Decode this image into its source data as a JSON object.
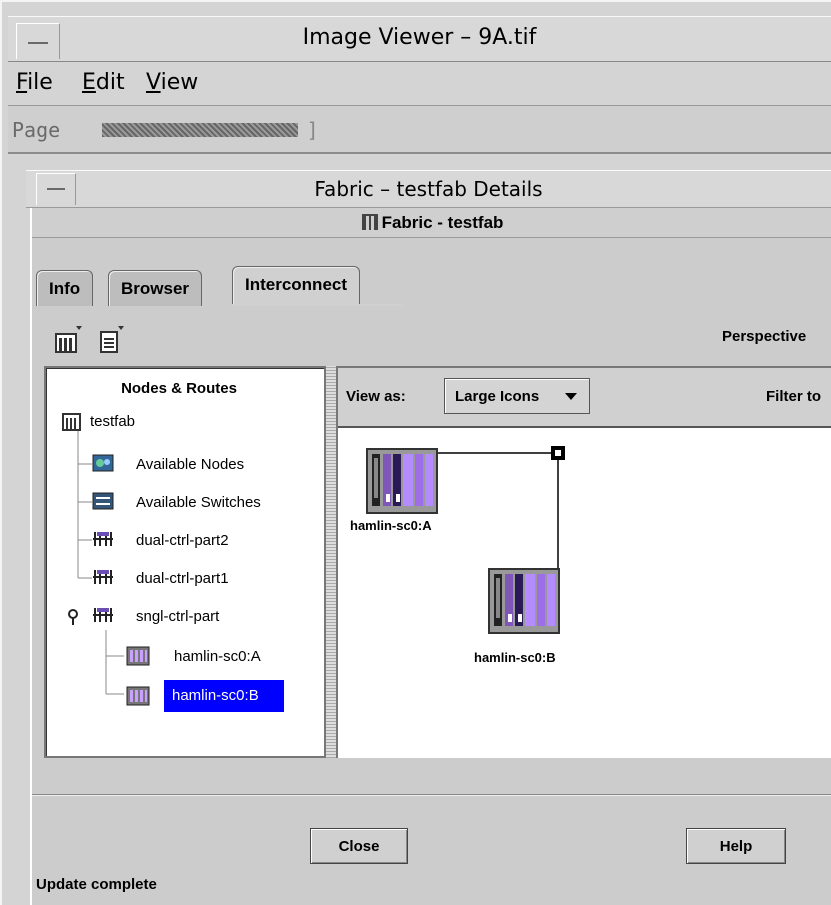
{
  "window": {
    "title": "Image Viewer – 9A.tif"
  },
  "menu": {
    "file": "File",
    "edit": "Edit",
    "view": "View"
  },
  "pagebar": {
    "label": "Page",
    "bracket": "]"
  },
  "inner_window": {
    "title": "Fabric – testfab Details"
  },
  "dialog": {
    "header": "Fabric - testfab",
    "tabs": [
      {
        "label": "Info"
      },
      {
        "label": "Browser"
      },
      {
        "label": "Interconnect"
      }
    ],
    "perspective_label": "Perspective",
    "tree": {
      "title": "Nodes & Routes",
      "items": [
        {
          "label": "testfab",
          "icon": "fabric-icon"
        },
        {
          "label": "Available Nodes",
          "icon": "nodes-icon"
        },
        {
          "label": "Available Switches",
          "icon": "switches-icon"
        },
        {
          "label": "dual-ctrl-part2",
          "icon": "partition-icon"
        },
        {
          "label": "dual-ctrl-part1",
          "icon": "partition-icon"
        },
        {
          "label": "sngl-ctrl-part",
          "icon": "partition-icon"
        },
        {
          "label": "hamlin-sc0:A",
          "icon": "node-icon"
        },
        {
          "label": "hamlin-sc0:B",
          "icon": "node-icon",
          "selected": true
        }
      ]
    },
    "view_as": {
      "label": "View as:",
      "value": "Large Icons"
    },
    "filter_label": "Filter to",
    "canvas_nodes": [
      {
        "label": "hamlin-sc0:A"
      },
      {
        "label": "hamlin-sc0:B"
      }
    ],
    "buttons": {
      "close": "Close",
      "help": "Help"
    },
    "status": "Update complete"
  },
  "colors": {
    "selection": "#0000ff",
    "node_purple": "#9966cc"
  }
}
